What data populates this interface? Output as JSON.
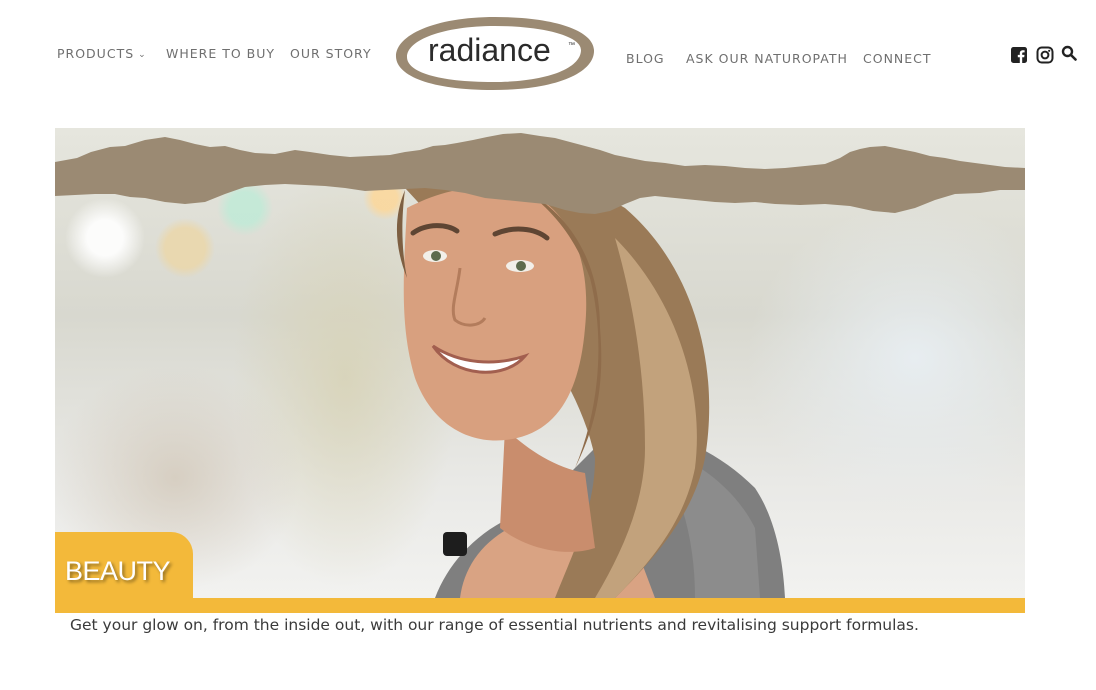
{
  "header": {
    "nav_left": [
      {
        "label": "PRODUCTS",
        "has_dropdown": true
      },
      {
        "label": "WHERE TO BUY"
      },
      {
        "label": "OUR STORY"
      }
    ],
    "logo_text": "radiance",
    "logo_tm": "™",
    "nav_right": [
      {
        "label": "BLOG"
      },
      {
        "label": "ASK OUR NATUROPATH"
      },
      {
        "label": "CONNECT"
      }
    ],
    "icons": [
      "facebook-icon",
      "instagram-icon",
      "search-icon"
    ]
  },
  "hero": {
    "category": "BEAUTY",
    "tagline": "Get your glow on, from the inside out, with our range of essential nutrients and revitalising support formulas."
  },
  "colors": {
    "brand_taupe": "#9b8a73",
    "accent_yellow": "#f3b93a",
    "nav_text": "#6f6f6f",
    "icon_dark": "#222222"
  }
}
